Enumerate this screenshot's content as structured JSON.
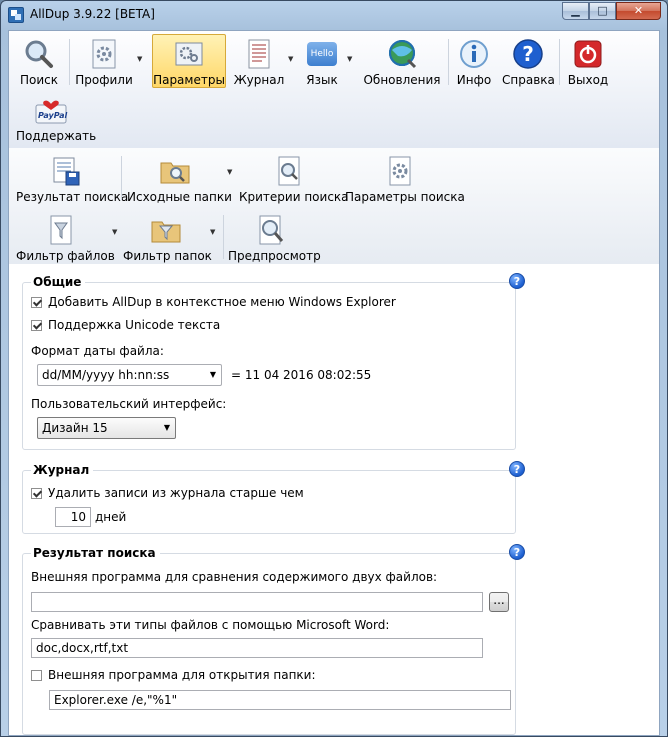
{
  "window": {
    "title": "AllDup 3.9.22 [BETA]",
    "min_symbol": "▁",
    "max_symbol": "□",
    "close_symbol": "✕"
  },
  "toolbar1": [
    {
      "id": "search",
      "label": "Поиск",
      "icon": "magnifier-icon"
    },
    {
      "id": "profiles",
      "label": "Профили",
      "icon": "profile-gear-icon"
    },
    {
      "id": "settings",
      "label": "Параметры",
      "icon": "settings-icon",
      "active": true
    },
    {
      "id": "log",
      "label": "Журнал",
      "icon": "log-icon"
    },
    {
      "id": "language",
      "label": "Язык",
      "icon": "hello-bubble-icon"
    },
    {
      "id": "updates",
      "label": "Обновления",
      "icon": "globe-icon"
    },
    {
      "id": "info",
      "label": "Инфо",
      "icon": "info-icon"
    },
    {
      "id": "help",
      "label": "Справка",
      "icon": "question-icon"
    },
    {
      "id": "exit",
      "label": "Выход",
      "icon": "power-icon"
    }
  ],
  "donate": {
    "label": "Поддержать",
    "badge": "PayPal"
  },
  "language_badge": "Hello",
  "toolbar2": [
    {
      "id": "search-result",
      "label": "Результат поиска"
    },
    {
      "id": "source-folders",
      "label": "Исходные папки"
    },
    {
      "id": "search-criteria",
      "label": "Критерии поиска"
    },
    {
      "id": "search-params",
      "label": "Параметры поиска"
    }
  ],
  "toolbar3": [
    {
      "id": "file-filter",
      "label": "Фильтр файлов"
    },
    {
      "id": "folder-filter",
      "label": "Фильтр папок"
    },
    {
      "id": "preview",
      "label": "Предпросмотр"
    }
  ],
  "general": {
    "title": "Общие",
    "explorer_menu": "Добавить AllDup в контекстное меню Windows Explorer",
    "unicode": "Поддержка Unicode текста",
    "date_format_label": "Формат даты файла:",
    "date_format_value": "dd/MM/yyyy hh:nn:ss",
    "date_preview": "= 11 04 2016 08:02:55",
    "ui_label": "Пользовательский интерфейс:",
    "ui_value": "Дизайн 15"
  },
  "journal": {
    "title": "Журнал",
    "delete_label": "Удалить записи из журнала старше чем",
    "days_value": "10",
    "days_unit": "дней"
  },
  "result": {
    "title": "Результат поиска",
    "compare_label": "Внешняя программа для сравнения содержимого двух файлов:",
    "compare_value": "",
    "browse_label": "...",
    "word_label": "Сравнивать эти типы файлов с помощью Microsoft Word:",
    "word_value": "doc,docx,rtf,txt",
    "open_folder_label": "Внешняя программа для открытия папки:",
    "open_folder_value": "Explorer.exe /e,\"%1\""
  },
  "help_glyph": "?",
  "dropdown_glyph": "▼"
}
